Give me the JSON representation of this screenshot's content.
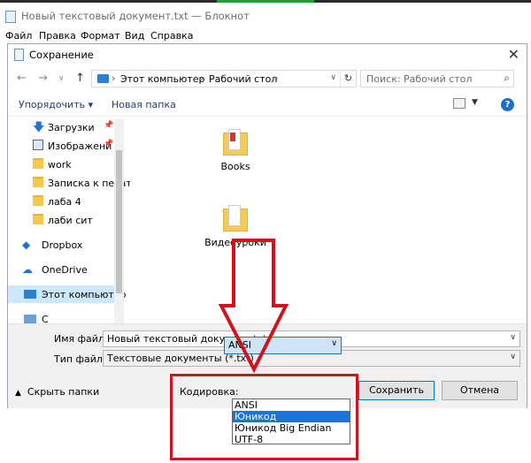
{
  "notepad": {
    "title": "Новый текстовый документ.txt — Блокнот",
    "menu": [
      "Файл",
      "Правка",
      "Формат",
      "Вид",
      "Справка"
    ]
  },
  "dialog": {
    "title": "Сохранение",
    "close_glyph": "✕",
    "address": [
      "Этот компьютер",
      "Рабочий стол"
    ],
    "search_placeholder": "Поиск: Рабочий стол",
    "toolbar": {
      "organize": "Упорядочить ▾",
      "new_folder": "Новая папка",
      "help": "?"
    },
    "sidebar": [
      {
        "label": "Загрузки",
        "icon": "download-icon",
        "pinned": true
      },
      {
        "label": "Изображени",
        "icon": "pictures-icon",
        "pinned": true
      },
      {
        "label": "work",
        "icon": "folder-icon",
        "pinned": false
      },
      {
        "label": "Записка к печат",
        "icon": "folder-icon",
        "pinned": false
      },
      {
        "label": "лаба 4",
        "icon": "folder-icon",
        "pinned": false
      },
      {
        "label": "лаби сит",
        "icon": "folder-icon",
        "pinned": false
      },
      {
        "label": "Dropbox",
        "icon": "dropbox-icon",
        "pinned": false
      },
      {
        "label": "OneDrive",
        "icon": "onedrive-icon",
        "pinned": false
      },
      {
        "label": "Этот компьютер",
        "icon": "computer-icon",
        "pinned": false
      },
      {
        "label": "С",
        "icon": "network-icon",
        "pinned": false
      }
    ],
    "files": [
      {
        "label": "Books"
      },
      {
        "label": "Видеоуроки"
      }
    ],
    "form": {
      "filename_label": "Имя файла:",
      "filename_value": "Новый текстовый документ.txt",
      "filetype_label": "Тип файла:",
      "filetype_value": "Текстовые документы (*.txt)",
      "hide_folders": "Скрыть папки",
      "encoding_label": "Кодировка:",
      "encoding_value": "ANSI",
      "encoding_options": [
        "ANSI",
        "Юникод",
        "Юникод Big Endian",
        "UTF-8"
      ],
      "encoding_highlighted": "Юникод",
      "save_button": "Сохранить",
      "cancel_button": "Отмена"
    }
  },
  "annotation": {
    "color": "#d0131c"
  }
}
